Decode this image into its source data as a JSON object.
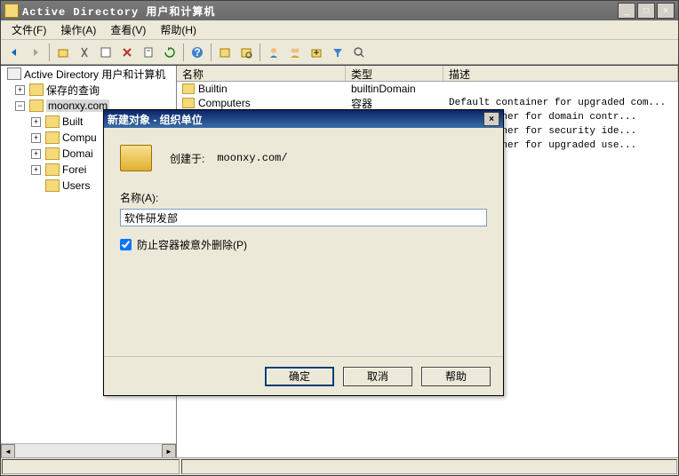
{
  "window": {
    "title": "Active Directory 用户和计算机"
  },
  "menu": {
    "file": "文件(F)",
    "action": "操作(A)",
    "view": "查看(V)",
    "help": "帮助(H)"
  },
  "tree": {
    "root": "Active Directory 用户和计算机",
    "saved_queries": "保存的查询",
    "domain": "moonxy.com",
    "children": [
      {
        "label": "Built"
      },
      {
        "label": "Compu"
      },
      {
        "label": "Domai"
      },
      {
        "label": "Forei"
      },
      {
        "label": "Users"
      }
    ]
  },
  "list": {
    "headers": {
      "name": "名称",
      "type": "类型",
      "desc": "描述"
    },
    "rows": [
      {
        "name": "Builtin",
        "type": "builtinDomain",
        "desc": ""
      },
      {
        "name": "Computers",
        "type": "容器",
        "desc": "Default container for upgraded com..."
      },
      {
        "name": "",
        "type": "",
        "desc": "lt container for domain contr..."
      },
      {
        "name": "",
        "type": "",
        "desc": "lt container for security ide..."
      },
      {
        "name": "",
        "type": "",
        "desc": "lt container for upgraded use..."
      }
    ]
  },
  "dialog": {
    "title": "新建对象 - 组织单位",
    "created_label": "创建于:",
    "created_path": "moonxy.com/",
    "name_label": "名称(A):",
    "name_value": "软件研发部",
    "protect_label": "防止容器被意外删除(P)",
    "protect_checked": true,
    "ok": "确定",
    "cancel": "取消",
    "help": "帮助"
  }
}
